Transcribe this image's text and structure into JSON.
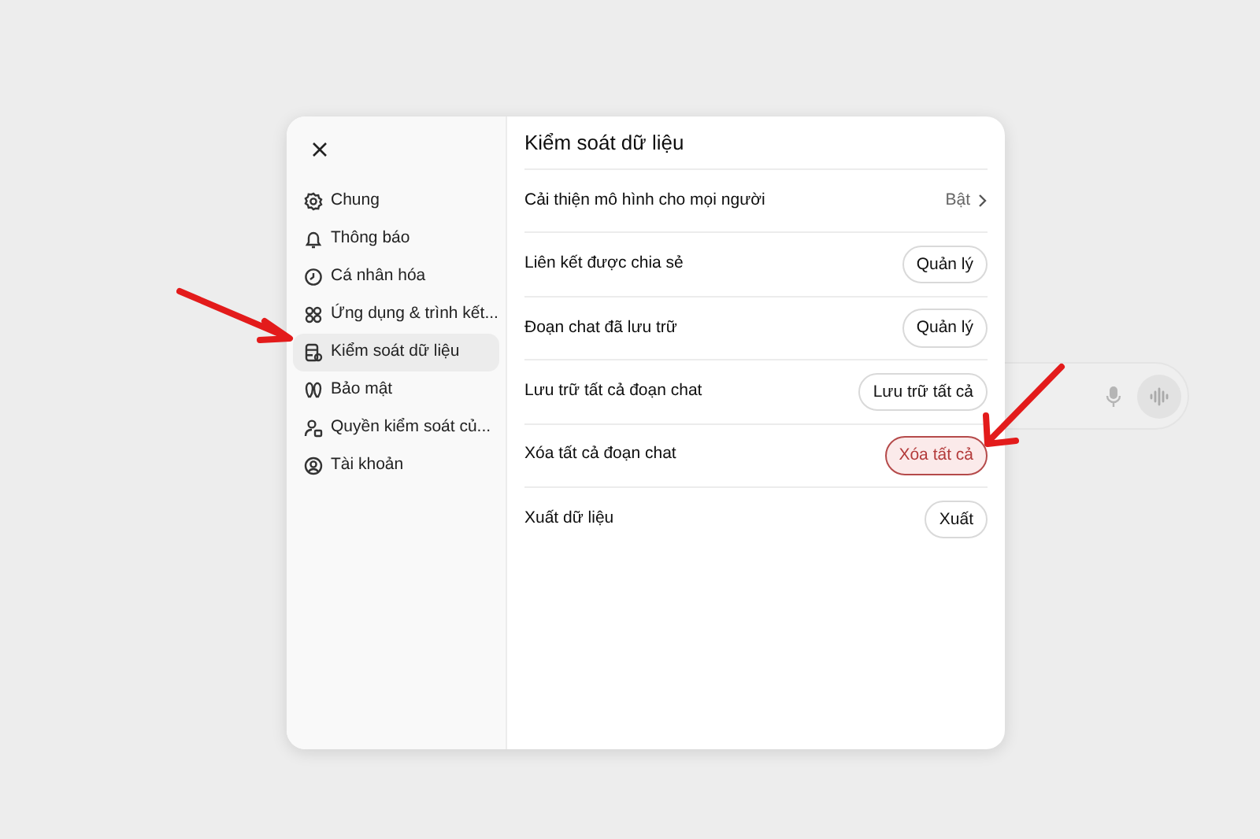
{
  "sidebar": {
    "items": [
      {
        "label": "Chung",
        "selected": false
      },
      {
        "label": "Thông báo",
        "selected": false
      },
      {
        "label": "Cá nhân hóa",
        "selected": false
      },
      {
        "label": "Ứng dụng & trình kết...",
        "selected": false
      },
      {
        "label": "Kiểm soát dữ liệu",
        "selected": true
      },
      {
        "label": "Bảo mật",
        "selected": false
      },
      {
        "label": "Quyền kiểm soát củ...",
        "selected": false
      },
      {
        "label": "Tài khoản",
        "selected": false
      }
    ]
  },
  "panel": {
    "title": "Kiểm soát dữ liệu",
    "rows": [
      {
        "label": "Cải thiện mô hình cho mọi người",
        "kind": "link",
        "value": "Bật"
      },
      {
        "label": "Liên kết được chia sẻ",
        "kind": "button",
        "value": "Quản lý"
      },
      {
        "label": "Đoạn chat đã lưu trữ",
        "kind": "button",
        "value": "Quản lý"
      },
      {
        "label": "Lưu trữ tất cả đoạn chat",
        "kind": "button",
        "value": "Lưu trữ tất cả"
      },
      {
        "label": "Xóa tất cả đoạn chat",
        "kind": "danger",
        "value": "Xóa tất cả"
      },
      {
        "label": "Xuất dữ liệu",
        "kind": "button",
        "value": "Xuất"
      }
    ]
  }
}
